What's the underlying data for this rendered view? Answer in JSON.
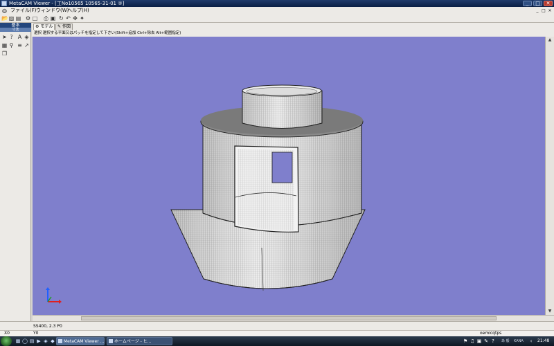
{
  "window": {
    "title": "MetaCAM Viewer - [工No10565 10565-31-01 ②]",
    "minimize": "_",
    "maximize": "□",
    "close": "✕"
  },
  "menu": {
    "items": [
      "ファイル(F)",
      "ウィンドウ(W)",
      "ヘルプ(H)"
    ],
    "mdi_buttons": [
      "_",
      "□",
      "×"
    ]
  },
  "left_panel": {
    "header": "基本",
    "subheader": "寸法"
  },
  "tabs": [
    {
      "label": "モデル",
      "icon": "model-icon"
    },
    {
      "label": "作図",
      "icon": "pencil-icon"
    }
  ],
  "hint": "選択 選択する平面又はパッチを指定して下さい(Shift+追加 Ctrl+除去 Alt+範囲指定)",
  "status": {
    "text": "SS400, 2.3 P0"
  },
  "coords": {
    "x": "X0",
    "y": "Y0"
  },
  "user_name": "oemicqtps",
  "taskbar": {
    "tasks": [
      {
        "label": "MetaCAM Viewer ...",
        "active": true
      },
      {
        "label": "ホームページ - ヒ...",
        "active": false
      }
    ],
    "tray_labels": [
      "あ 般",
      "KANA"
    ],
    "clock": "21:48"
  },
  "colors": {
    "viewport_bg": "#7f7fcc",
    "titlebar": "#0a1f45",
    "panel_header": "#23467d",
    "model_surface": "#e9e9e9",
    "axis_x": "#e02020",
    "axis_y": "#2060ff"
  }
}
